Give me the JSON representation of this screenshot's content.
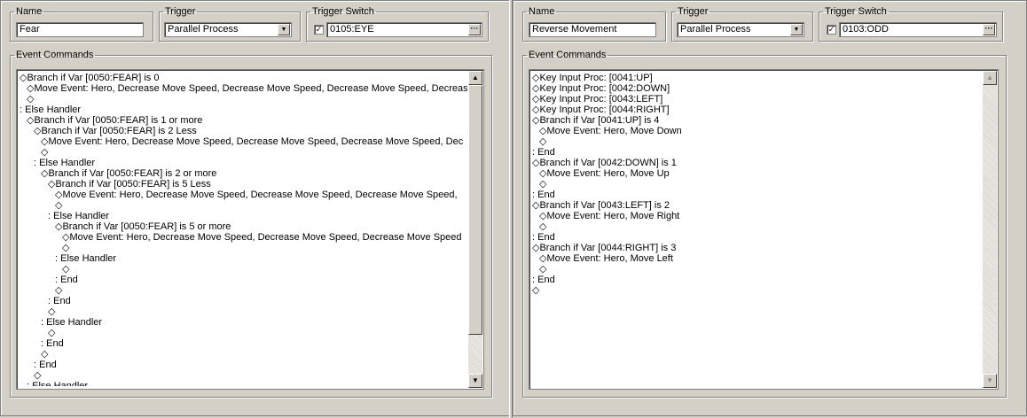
{
  "left": {
    "name": {
      "label": "Name",
      "value": "Fear"
    },
    "trigger": {
      "label": "Trigger",
      "value": "Parallel Process"
    },
    "trigger_switch": {
      "label": "Trigger Switch",
      "checked": true,
      "value": "0105:EYE",
      "button": "···"
    },
    "event_commands": {
      "label": "Event Commands",
      "lines": [
        {
          "indent": 0,
          "text": "◇Branch if Var [0050:FEAR] is 0"
        },
        {
          "indent": 1,
          "text": "◇Move Event: Hero, Decrease Move Speed, Decrease Move Speed, Decrease Move Speed, Decrease"
        },
        {
          "indent": 1,
          "text": "◇"
        },
        {
          "indent": 0,
          "text": ": Else Handler"
        },
        {
          "indent": 1,
          "text": "◇Branch if Var [0050:FEAR] is 1 or more"
        },
        {
          "indent": 2,
          "text": "◇Branch if Var [0050:FEAR] is 2 Less"
        },
        {
          "indent": 3,
          "text": "◇Move Event: Hero, Decrease Move Speed, Decrease Move Speed, Decrease Move Speed, Dec"
        },
        {
          "indent": 3,
          "text": "◇"
        },
        {
          "indent": 2,
          "text": ": Else Handler"
        },
        {
          "indent": 3,
          "text": "◇Branch if Var [0050:FEAR] is 2 or more"
        },
        {
          "indent": 4,
          "text": "◇Branch if Var [0050:FEAR] is 5 Less"
        },
        {
          "indent": 5,
          "text": "◇Move Event: Hero, Decrease Move Speed, Decrease Move Speed, Decrease Move Speed,"
        },
        {
          "indent": 5,
          "text": "◇"
        },
        {
          "indent": 4,
          "text": ": Else Handler"
        },
        {
          "indent": 5,
          "text": "◇Branch if Var [0050:FEAR] is 5 or more"
        },
        {
          "indent": 6,
          "text": "◇Move Event: Hero, Decrease Move Speed, Decrease Move Speed, Decrease Move Speed"
        },
        {
          "indent": 6,
          "text": "◇"
        },
        {
          "indent": 5,
          "text": ": Else Handler"
        },
        {
          "indent": 6,
          "text": "◇"
        },
        {
          "indent": 5,
          "text": ": End"
        },
        {
          "indent": 5,
          "text": "◇"
        },
        {
          "indent": 4,
          "text": ": End"
        },
        {
          "indent": 4,
          "text": "◇"
        },
        {
          "indent": 3,
          "text": ": Else Handler"
        },
        {
          "indent": 4,
          "text": "◇"
        },
        {
          "indent": 3,
          "text": ": End"
        },
        {
          "indent": 3,
          "text": "◇"
        },
        {
          "indent": 2,
          "text": ": End"
        },
        {
          "indent": 2,
          "text": "◇"
        },
        {
          "indent": 1,
          "text": ": Else Handler"
        }
      ]
    }
  },
  "right": {
    "name": {
      "label": "Name",
      "value": "Reverse Movement"
    },
    "trigger": {
      "label": "Trigger",
      "value": "Parallel Process"
    },
    "trigger_switch": {
      "label": "Trigger Switch",
      "checked": true,
      "value": "0103:ODD",
      "button": "···"
    },
    "event_commands": {
      "label": "Event Commands",
      "lines": [
        {
          "indent": 0,
          "text": "◇Key Input Proc: [0041:UP]"
        },
        {
          "indent": 0,
          "text": "◇Key Input Proc: [0042:DOWN]"
        },
        {
          "indent": 0,
          "text": "◇Key Input Proc: [0043:LEFT]"
        },
        {
          "indent": 0,
          "text": "◇Key Input Proc: [0044:RIGHT]"
        },
        {
          "indent": 0,
          "text": "◇Branch if Var [0041:UP] is 4"
        },
        {
          "indent": 1,
          "text": "◇Move Event: Hero, Move Down"
        },
        {
          "indent": 1,
          "text": "◇"
        },
        {
          "indent": 0,
          "text": ": End"
        },
        {
          "indent": 0,
          "text": "◇Branch if Var [0042:DOWN] is 1"
        },
        {
          "indent": 1,
          "text": "◇Move Event: Hero, Move Up"
        },
        {
          "indent": 1,
          "text": "◇"
        },
        {
          "indent": 0,
          "text": ": End"
        },
        {
          "indent": 0,
          "text": "◇Branch if Var [0043:LEFT] is 2"
        },
        {
          "indent": 1,
          "text": "◇Move Event: Hero, Move Right"
        },
        {
          "indent": 1,
          "text": "◇"
        },
        {
          "indent": 0,
          "text": ": End"
        },
        {
          "indent": 0,
          "text": "◇Branch if Var [0044:RIGHT] is 3"
        },
        {
          "indent": 1,
          "text": "◇Move Event: Hero, Move Left"
        },
        {
          "indent": 1,
          "text": "◇"
        },
        {
          "indent": 0,
          "text": ": End"
        },
        {
          "indent": 0,
          "text": "◇"
        }
      ]
    }
  },
  "icons": {
    "dropdown": "chevron-down-icon",
    "scroll_up": "arrow-up-icon",
    "scroll_down": "arrow-down-icon",
    "check": "checkmark-icon"
  }
}
